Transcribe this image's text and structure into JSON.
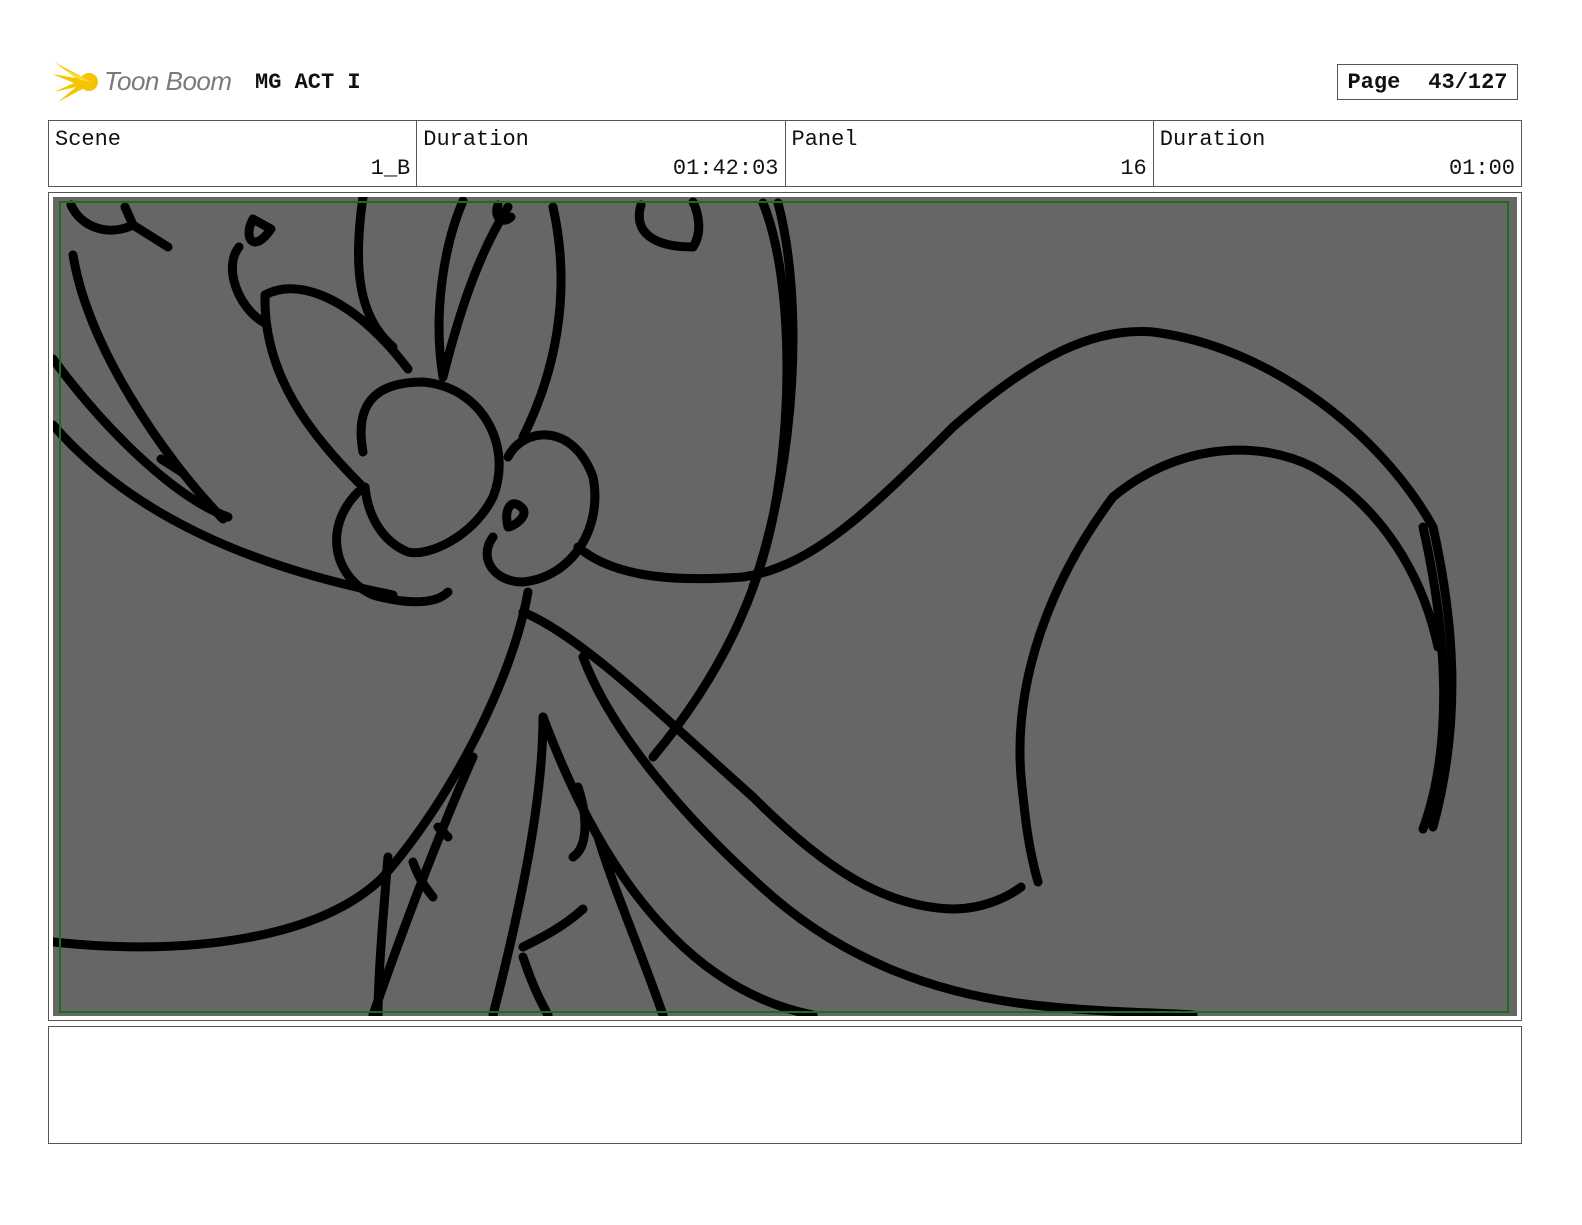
{
  "header": {
    "logo_text": "Toon Boom",
    "project_title": "MG ACT I",
    "page_label": "Page",
    "page_value": "43/127"
  },
  "info": {
    "scene_label": "Scene",
    "scene_value": "1_B",
    "scene_duration_label": "Duration",
    "scene_duration_value": "01:42:03",
    "panel_label": "Panel",
    "panel_value": "16",
    "panel_duration_label": "Duration",
    "panel_duration_value": "01:00"
  },
  "notes": {
    "text": ""
  },
  "colors": {
    "canvas": "#666666",
    "ink": "#000000",
    "safe_frame": "#1d6b1d",
    "logo_yellow": "#f5c400",
    "logo_gray": "#7a7a7a"
  },
  "icons": {
    "logo": "toon-boom-starburst-icon"
  }
}
